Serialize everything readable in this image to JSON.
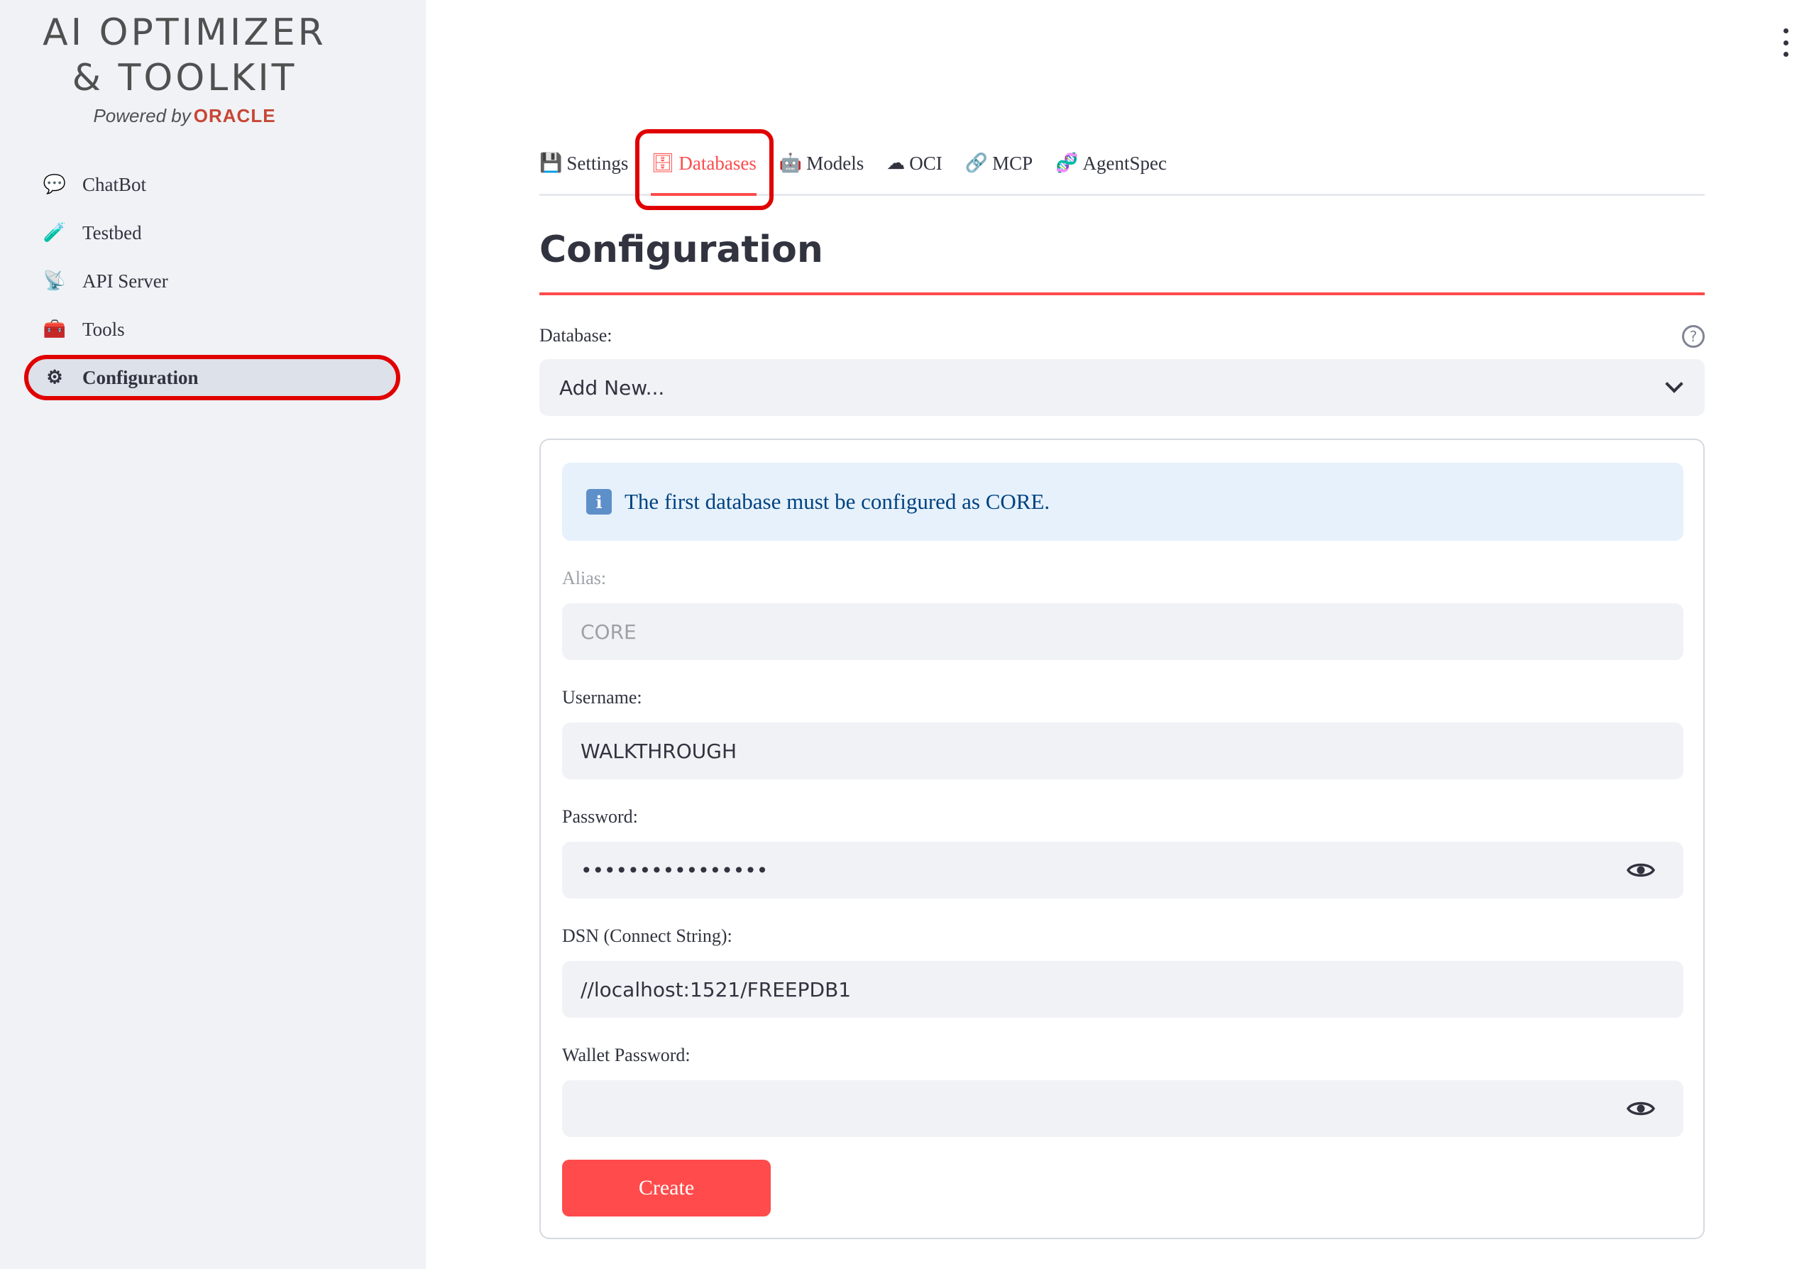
{
  "app": {
    "logo_line1": "AI OPTIMIZER",
    "logo_line2": "& TOOLKIT",
    "powered_by": "Powered by",
    "oracle": "ORACLE"
  },
  "sidebar": {
    "items": [
      {
        "label": "ChatBot",
        "icon": "speech-bubble-icon",
        "glyph": "💬"
      },
      {
        "label": "Testbed",
        "icon": "test-tube-icon",
        "glyph": "🧪"
      },
      {
        "label": "API Server",
        "icon": "satellite-dish-icon",
        "glyph": "📡"
      },
      {
        "label": "Tools",
        "icon": "toolbox-icon",
        "glyph": "🧰"
      },
      {
        "label": "Configuration",
        "icon": "gear-icon",
        "glyph": "⚙"
      }
    ],
    "active_index": 4
  },
  "tabs": [
    {
      "label": "Settings",
      "icon": "floppy-disk-icon",
      "glyph": "💾"
    },
    {
      "label": "Databases",
      "icon": "database-icon",
      "glyph": "🗄"
    },
    {
      "label": "Models",
      "icon": "robot-icon",
      "glyph": "🤖"
    },
    {
      "label": "OCI",
      "icon": "cloud-icon",
      "glyph": "☁"
    },
    {
      "label": "MCP",
      "icon": "link-icon",
      "glyph": "🔗"
    },
    {
      "label": "AgentSpec",
      "icon": "dna-icon",
      "glyph": "🧬"
    }
  ],
  "active_tab_index": 1,
  "main": {
    "title": "Configuration",
    "database_label": "Database:",
    "database_value": "Add New...",
    "info_icon": "i",
    "info": "The first database must be configured as CORE.",
    "alias_label": "Alias:",
    "alias_value": "CORE",
    "username_label": "Username:",
    "username_value": "WALKTHROUGH",
    "password_label": "Password:",
    "password_value": "••••••••••••••••",
    "dsn_label": "DSN (Connect String):",
    "dsn_value": "//localhost:1521/FREEPDB1",
    "wallet_label": "Wallet Password:",
    "wallet_value": "",
    "create_label": "Create",
    "help_glyph": "?"
  },
  "colors": {
    "accent": "#ff4b4b",
    "highlight": "#e00000",
    "sidebar_bg": "#f0f2f6",
    "input_bg": "#f0f2f6",
    "info_bg": "#e6f1fc",
    "info_text": "#004280",
    "oracle_red": "#c74634"
  }
}
